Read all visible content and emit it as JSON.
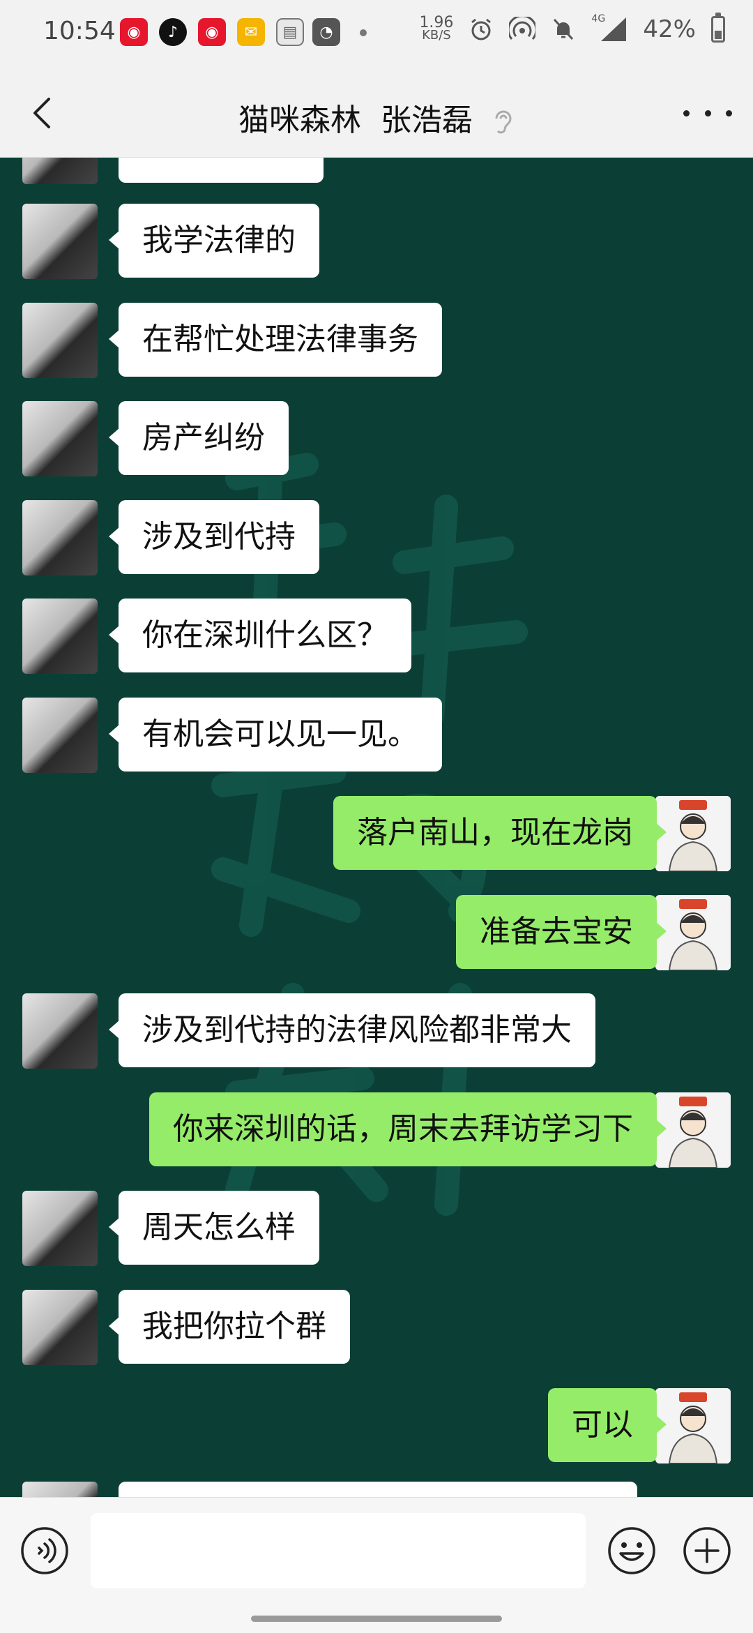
{
  "status_bar": {
    "time": "10:54",
    "net_speed_value": "1.96",
    "net_speed_unit": "KB/S",
    "network": "4G",
    "battery": "42%",
    "battery_level": 0.42,
    "app_icons": [
      "weibo-icon",
      "tiktok-icon",
      "weibo-icon",
      "mail-icon",
      "document-icon",
      "app-icon"
    ]
  },
  "header": {
    "title": "猫咪森林  张浩磊",
    "back_icon": "chevron-left-icon",
    "more_icon": "more-dots-icon",
    "ear_icon": "earpiece-icon"
  },
  "colors": {
    "chat_background": "#0b3f36",
    "incoming_bubble": "#ffffff",
    "outgoing_bubble": "#95ec69"
  },
  "messages": [
    {
      "side": "left",
      "text": "我学法律的"
    },
    {
      "side": "left",
      "text": "在帮忙处理法律事务"
    },
    {
      "side": "left",
      "text": "房产纠纷"
    },
    {
      "side": "left",
      "text": "涉及到代持"
    },
    {
      "side": "left",
      "text": "你在深圳什么区？"
    },
    {
      "side": "left",
      "text": "有机会可以见一见。"
    },
    {
      "side": "right",
      "text": "落户南山，现在龙岗"
    },
    {
      "side": "right",
      "text": "准备去宝安"
    },
    {
      "side": "left",
      "text": "涉及到代持的法律风险都非常大"
    },
    {
      "side": "right",
      "text": "你来深圳的话，周末去拜访学习下"
    },
    {
      "side": "left",
      "text": "周天怎么样"
    },
    {
      "side": "left",
      "text": "我把你拉个群"
    },
    {
      "side": "right",
      "text": "可以"
    }
  ],
  "input_bar": {
    "placeholder": "",
    "voice_icon": "voice-icon",
    "emoji_icon": "emoji-icon",
    "plus_icon": "plus-icon"
  }
}
